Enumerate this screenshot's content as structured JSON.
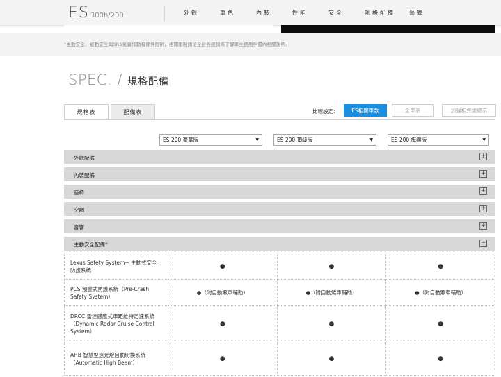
{
  "header": {
    "logo_main": "ES",
    "logo_sub": "300h/200",
    "nav": [
      "外觀",
      "車色",
      "內裝",
      "性能",
      "安全",
      "規格配備",
      "藝廊"
    ]
  },
  "disclaimer": "*主動安全、被動安全與SRS氣囊作動有條件限制，相關限制請洽全台各經銷商了解車主使用手冊內相關說明。",
  "title": {
    "en": "SPEC. /",
    "zh": "規格配備"
  },
  "tabs": [
    "規格表",
    "配備表"
  ],
  "compare": {
    "label": "比較設定:",
    "primary": "ES相關車款",
    "secondary": "全車系",
    "tertiary": "加強相異處顯示"
  },
  "selects": [
    "ES 200 豪華版",
    "ES 200 頂級版",
    "ES 200 旗艦版"
  ],
  "sections": [
    {
      "label": "外觀配備",
      "toggle": "+"
    },
    {
      "label": "內裝配備",
      "toggle": "+"
    },
    {
      "label": "座椅",
      "toggle": "+"
    },
    {
      "label": "空調",
      "toggle": "+"
    },
    {
      "label": "音響",
      "toggle": "+"
    },
    {
      "label": "主動安全配備*",
      "toggle": "−"
    }
  ],
  "rows": [
    {
      "name": "Lexus Safety System+ 主動式安全防護系統",
      "values": [
        "●",
        "●",
        "●"
      ]
    },
    {
      "name": "PCS 預警式防護系統（Pre-Crash Safety System）",
      "values": [
        "●（附自動煞車輔助）",
        "●（附自動煞車輔助）",
        "●（附自動煞車輔助）"
      ]
    },
    {
      "name": "DRCC 雷達感應式車距維持定速系統（Dynamic Radar Cruise Control System）",
      "values": [
        "●",
        "●",
        "●"
      ]
    },
    {
      "name": "AHB 智慧型遠光燈自動切換系統（Automatic High Beam）",
      "values": [
        "●",
        "●",
        "●"
      ]
    }
  ]
}
